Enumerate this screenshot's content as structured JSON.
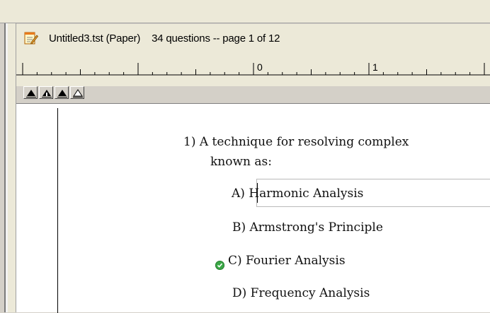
{
  "document": {
    "title": "Untitled3.tst (Paper)",
    "info": "34 questions -- page 1 of 12",
    "icon": "test-document-icon"
  },
  "ruler": {
    "labels": [
      "0",
      "1"
    ],
    "alignment_buttons": [
      "align-left-triangle-icon",
      "align-center-triangle-icon",
      "align-right-triangle-icon",
      "align-decimal-triangle-icon"
    ]
  },
  "question": {
    "number": "1)",
    "text_line1": "A technique for resolving complex",
    "text_line2": "known as:",
    "choices": [
      {
        "label": "A)",
        "text": "Harmonic Analysis",
        "correct": false
      },
      {
        "label": "B)",
        "text": "Armstrong's Principle",
        "correct": false
      },
      {
        "label": "C)",
        "text": "Fourier Analysis",
        "correct": true
      },
      {
        "label": "D)",
        "text": "Frequency Analysis",
        "correct": false
      }
    ]
  },
  "colors": {
    "chrome": "#ece9d8",
    "correct_mark": "#3aa846",
    "page": "#ffffff"
  }
}
